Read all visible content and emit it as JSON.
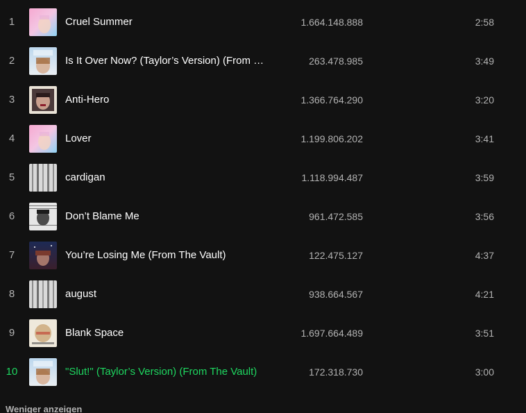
{
  "tracks": [
    {
      "num": "1",
      "title": "Cruel Summer",
      "plays": "1.664.148.888",
      "duration": "2:58",
      "cover": "lover-cover-icon"
    },
    {
      "num": "2",
      "title": "Is It Over Now? (Taylor’s Version) (From …",
      "plays": "263.478.985",
      "duration": "3:49",
      "cover": "1989-tv-cover-icon"
    },
    {
      "num": "3",
      "title": "Anti-Hero",
      "plays": "1.366.764.290",
      "duration": "3:20",
      "cover": "midnights-cover-icon"
    },
    {
      "num": "4",
      "title": "Lover",
      "plays": "1.199.806.202",
      "duration": "3:41",
      "cover": "lover-cover-icon"
    },
    {
      "num": "5",
      "title": "cardigan",
      "plays": "1.118.994.487",
      "duration": "3:59",
      "cover": "folklore-cover-icon"
    },
    {
      "num": "6",
      "title": "Don’t Blame Me",
      "plays": "961.472.585",
      "duration": "3:56",
      "cover": "reputation-cover-icon"
    },
    {
      "num": "7",
      "title": "You’re Losing Me (From The Vault)",
      "plays": "122.475.127",
      "duration": "4:37",
      "cover": "midnights-vault-cover-icon"
    },
    {
      "num": "8",
      "title": "august",
      "plays": "938.664.567",
      "duration": "4:21",
      "cover": "folklore-cover-icon"
    },
    {
      "num": "9",
      "title": "Blank Space",
      "plays": "1.697.664.489",
      "duration": "3:51",
      "cover": "1989-cover-icon"
    },
    {
      "num": "10",
      "title": "\"Slut!\" (Taylor’s Version) (From The Vault)",
      "plays": "172.318.730",
      "duration": "3:00",
      "cover": "1989-tv-cover-icon",
      "active": true
    }
  ],
  "show_less_label": "Weniger anzeigen",
  "colors": {
    "background": "#121212",
    "text_primary": "#ffffff",
    "text_secondary": "#b3b3b3",
    "accent_playing": "#1ed760"
  }
}
